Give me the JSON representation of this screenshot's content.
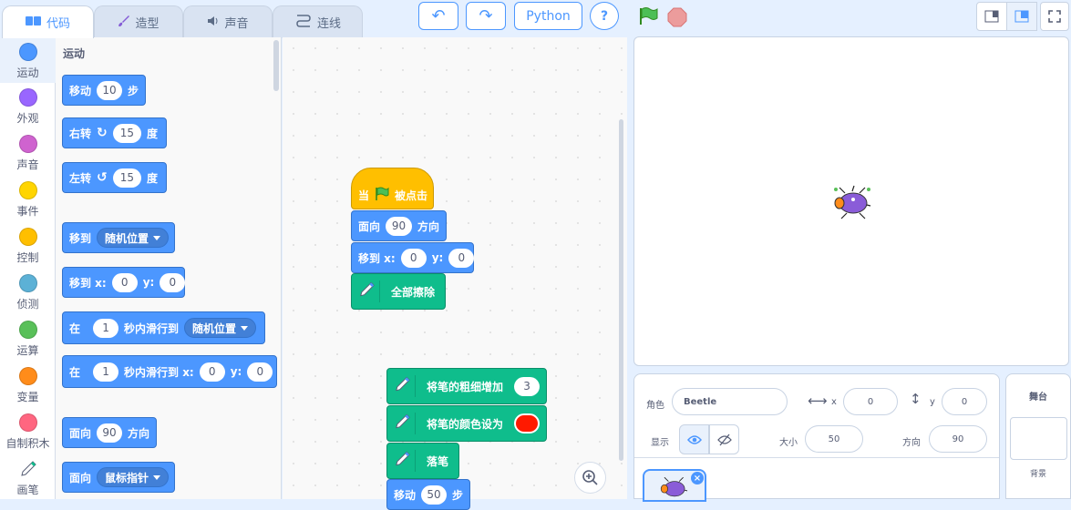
{
  "tabs": {
    "code": "代码",
    "costumes": "造型",
    "sounds": "声音",
    "connect": "连线"
  },
  "toolbar": {
    "undo": "↶",
    "redo": "↷",
    "python": "Python",
    "help": "?"
  },
  "colors": {
    "motion": "#4c97ff",
    "looks": "#9966ff",
    "sound": "#cf63cf",
    "events": "#ffbf00",
    "control": "#ffab19",
    "sensing": "#5cb1d6",
    "operators": "#59c059",
    "variables": "#ff8c1a",
    "myblocks": "#ff6680",
    "pen": "#0fbd8c"
  },
  "categories": [
    "运动",
    "外观",
    "声音",
    "事件",
    "控制",
    "侦测",
    "运算",
    "变量",
    "自制积木",
    "画笔"
  ],
  "palette": {
    "heading": "运动",
    "move": {
      "label": "移动",
      "value": "10",
      "unit": "步"
    },
    "turn_right": {
      "label": "右转",
      "value": "15",
      "unit": "度"
    },
    "turn_left": {
      "label": "左转",
      "value": "15",
      "unit": "度"
    },
    "goto": {
      "label": "移到",
      "option": "随机位置"
    },
    "goto_xy": {
      "label": "移到 x:",
      "x": "0",
      "ylabel": "y:",
      "y": "0"
    },
    "glide": {
      "label": "在",
      "secs": "1",
      "mid": "秒内滑行到",
      "option": "随机位置"
    },
    "glide_xy": {
      "label": "在",
      "secs": "1",
      "mid": "秒内滑行到 x:",
      "x": "0",
      "ylabel": "y:",
      "y": "0"
    },
    "point_dir": {
      "label": "面向",
      "value": "90",
      "unit": "方向"
    },
    "point_to": {
      "label": "面向",
      "option": "鼠标指针"
    }
  },
  "script1": {
    "hat": {
      "prefix": "当",
      "suffix": "被点击"
    },
    "point": {
      "label": "面向",
      "value": "90",
      "unit": "方向"
    },
    "goto": {
      "label": "移到 x:",
      "x": "0",
      "ylabel": "y:",
      "y": "0"
    },
    "clear": "全部擦除"
  },
  "script2": {
    "size": {
      "label": "将笔的粗细增加",
      "value": "3"
    },
    "color": {
      "label": "将笔的颜色设为",
      "swatch": "#ff1a00"
    },
    "pendown": "落笔",
    "move": {
      "label": "移动",
      "value": "50",
      "unit": "步"
    }
  },
  "sprite_info": {
    "sprite_label": "角色",
    "sprite_name": "Beetle",
    "x_label": "x",
    "x": "0",
    "y_label": "y",
    "y": "0",
    "show_label": "显示",
    "size_label": "大小",
    "size": "50",
    "direction_label": "方向",
    "direction": "90"
  },
  "stage_panel": {
    "title": "舞台",
    "backdrops": "背景"
  }
}
